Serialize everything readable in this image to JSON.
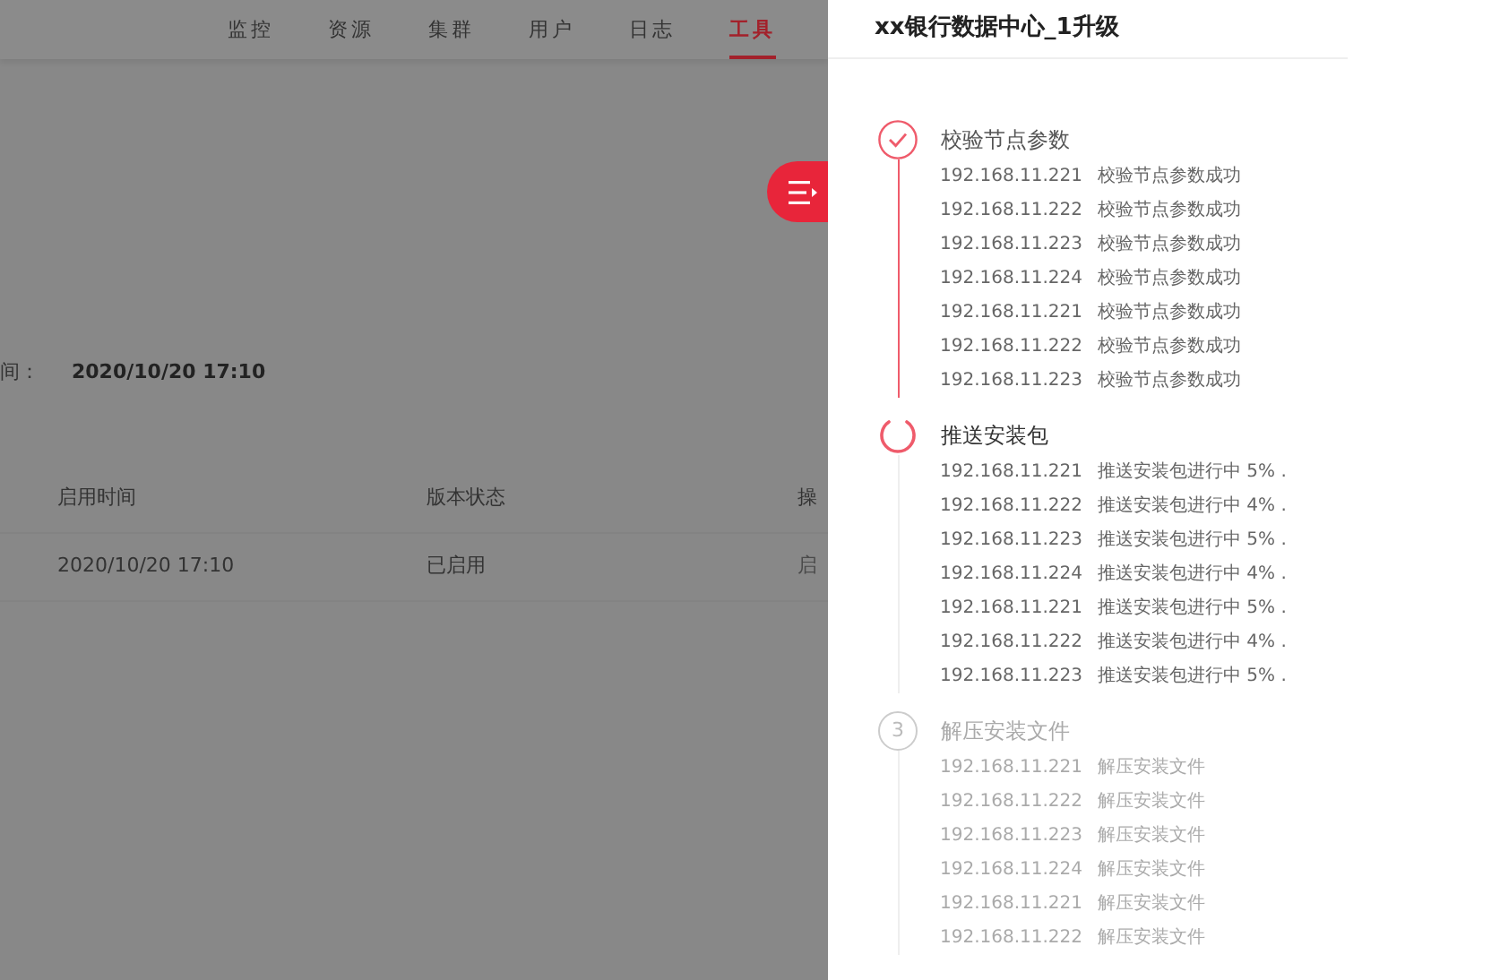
{
  "nav": {
    "tabs": [
      {
        "label": "监控",
        "selected": false
      },
      {
        "label": "资源",
        "selected": false
      },
      {
        "label": "集群",
        "selected": false
      },
      {
        "label": "用户",
        "selected": false
      },
      {
        "label": "日志",
        "selected": false
      },
      {
        "label": "工具",
        "selected": true
      }
    ]
  },
  "info": {
    "label": "间：",
    "value": "2020/10/20 17:10"
  },
  "table": {
    "columns": [
      "启用时间",
      "版本状态",
      "操"
    ],
    "rows": [
      [
        "2020/10/20 17:10",
        "已启用",
        "启"
      ]
    ]
  },
  "drawer": {
    "title": "xx银行数据中心_1升级",
    "steps": [
      {
        "kind": "done",
        "title": "校验节点参数",
        "rows": [
          [
            "192.168.11.221",
            "校验节点参数成功"
          ],
          [
            "192.168.11.222",
            "校验节点参数成功"
          ],
          [
            "192.168.11.223",
            "校验节点参数成功"
          ],
          [
            "192.168.11.224",
            "校验节点参数成功"
          ],
          [
            "192.168.11.221",
            "校验节点参数成功"
          ],
          [
            "192.168.11.222",
            "校验节点参数成功"
          ],
          [
            "192.168.11.223",
            "校验节点参数成功"
          ]
        ]
      },
      {
        "kind": "loading",
        "title": "推送安装包",
        "rows": [
          [
            "192.168.11.221",
            "推送安装包进行中 5% ."
          ],
          [
            "192.168.11.222",
            "推送安装包进行中 4% ."
          ],
          [
            "192.168.11.223",
            "推送安装包进行中 5% ."
          ],
          [
            "192.168.11.224",
            "推送安装包进行中 4% ."
          ],
          [
            "192.168.11.221",
            "推送安装包进行中 5% ."
          ],
          [
            "192.168.11.222",
            "推送安装包进行中 4% ."
          ],
          [
            "192.168.11.223",
            "推送安装包进行中 5% ."
          ]
        ]
      },
      {
        "kind": "pending",
        "number": "3",
        "title": "解压安装文件",
        "rows": [
          [
            "192.168.11.221",
            "解压安装文件"
          ],
          [
            "192.168.11.222",
            "解压安装文件"
          ],
          [
            "192.168.11.223",
            "解压安装文件"
          ],
          [
            "192.168.11.224",
            "解压安装文件"
          ],
          [
            "192.168.11.221",
            "解压安装文件"
          ],
          [
            "192.168.11.222",
            "解压安装文件"
          ]
        ]
      }
    ]
  }
}
